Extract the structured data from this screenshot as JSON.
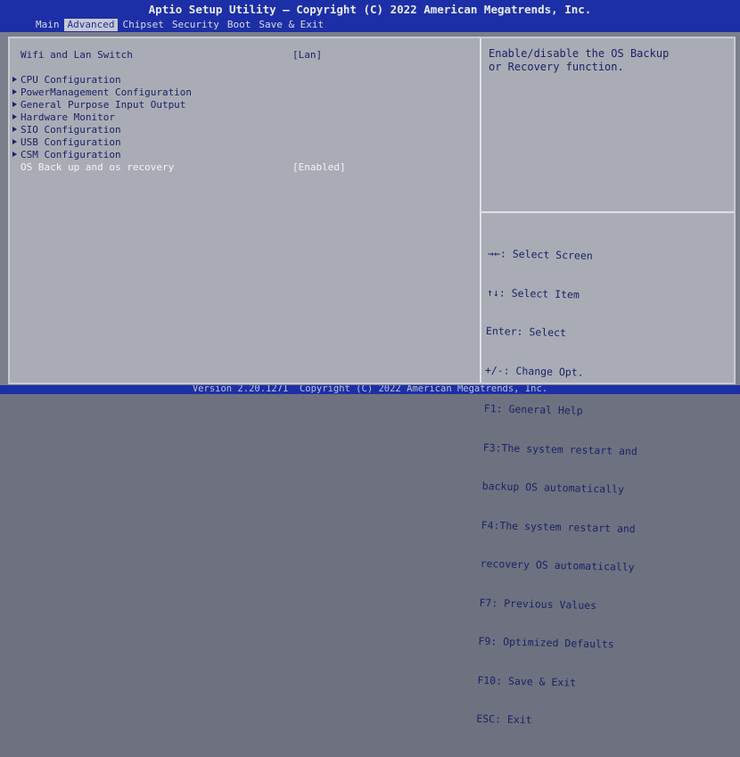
{
  "header": {
    "title": "Aptio Setup Utility – Copyright (C) 2022 American Megatrends, Inc.",
    "tabs": [
      "Main",
      "Advanced",
      "Chipset",
      "Security",
      "Boot",
      "Save & Exit"
    ],
    "active_tab": "Advanced"
  },
  "menu": {
    "items": [
      {
        "label": "Wifi and Lan Switch",
        "value": "[Lan]",
        "submenu": false
      },
      {
        "label": "CPU Configuration",
        "submenu": true
      },
      {
        "label": "PowerManagement Configuration",
        "submenu": true
      },
      {
        "label": "General Purpose Input Output",
        "submenu": true
      },
      {
        "label": "Hardware Monitor",
        "submenu": true
      },
      {
        "label": "SIO Configuration",
        "submenu": true
      },
      {
        "label": "USB Configuration",
        "submenu": true
      },
      {
        "label": "CSM Configuration",
        "submenu": true
      },
      {
        "label": "OS Back up and os recovery",
        "value": "[Enabled]",
        "submenu": false,
        "selected": true
      }
    ]
  },
  "help": {
    "description": "Enable/disable the OS Backup\nor Recovery function.",
    "keys": [
      "→←: Select Screen",
      "↑↓: Select Item",
      "Enter: Select",
      "+/-: Change Opt.",
      "F1: General Help",
      "F3:The system restart and",
      "backup OS automatically",
      "F4:The system restart and",
      "recovery OS automatically",
      "F7: Previous Values",
      "F9: Optimized Defaults",
      "F10: Save & Exit",
      "ESC: Exit"
    ]
  },
  "footer": {
    "version": "Version 2.20.1271  Copyright (C) 2022 American Megatrends, Inc."
  }
}
